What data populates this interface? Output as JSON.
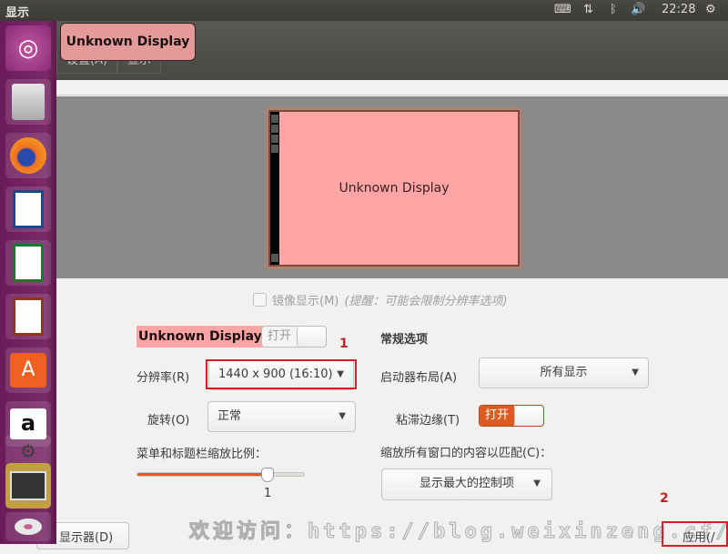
{
  "topbar": {
    "app_title": "显示",
    "clock": "22:28",
    "indicators": [
      "keyboard-icon",
      "network-icon",
      "bluetooth-icon",
      "volume-icon",
      "power-gear-icon"
    ]
  },
  "menu": {
    "items": [
      "设置(A)",
      "显示"
    ]
  },
  "tooltip": "Unknown Display",
  "launcher": {
    "items": [
      "Ubuntu Dash",
      "Files",
      "Firefox",
      "LibreOffice Writer",
      "LibreOffice Calc",
      "LibreOffice Impress",
      "Ubuntu Software",
      "Amazon",
      "System Settings",
      "Displays",
      "Disc"
    ]
  },
  "preview": {
    "monitor_label": "Unknown Display"
  },
  "mirror": {
    "label": "镜像显示(M)",
    "hint": "(提醒：可能会限制分辨率选项)",
    "checked": false
  },
  "display": {
    "name": "Unknown Display",
    "switch_label": "打开",
    "switch_on": false,
    "resolution_label": "分辨率(R)",
    "resolution_value": "1440 x 900 (16:10)",
    "rotation_label": "旋转(O)",
    "rotation_value": "正常",
    "scale_label": "菜单和标题栏缩放比例：",
    "scale_value": "1",
    "scale_fraction": 0.78
  },
  "general": {
    "title": "常规选项",
    "launcher_label": "启动器布局(A)",
    "launcher_value": "所有显示",
    "sticky_label": "粘滞边缘(T)",
    "sticky_switch": "打开",
    "sticky_on": true,
    "scale_all_label": "缩放所有窗口的内容以匹配(C)：",
    "scale_all_value": "显示最大的控制项"
  },
  "annotations": {
    "one": "1",
    "two": "2"
  },
  "buttons": {
    "detect": "显示器(D)",
    "apply": "应用(/"
  },
  "watermark": "欢迎访问：https://blog.weixinzeng.cf/",
  "colors": {
    "accent": "#dd5a20",
    "highlight": "#ffa5a5",
    "annotation": "#d0202a"
  }
}
